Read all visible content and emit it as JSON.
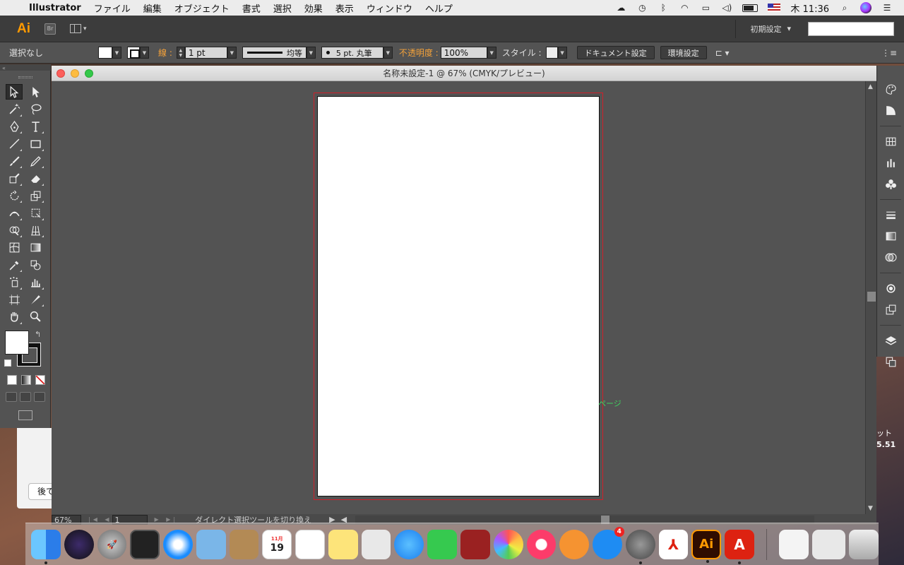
{
  "menubar": {
    "app_name": "Illustrator",
    "menus": [
      "ファイル",
      "編集",
      "オブジェクト",
      "書式",
      "選択",
      "効果",
      "表示",
      "ウィンドウ",
      "ヘルプ"
    ],
    "clock": "木 11:36"
  },
  "appbar": {
    "logo": "Ai",
    "bridge": "Br",
    "workspace": "初期設定"
  },
  "controlbar": {
    "selection": "選択なし",
    "stroke_label": "線 :",
    "stroke_weight": "1 pt",
    "profile": "均等",
    "brush": "5 pt. 丸筆",
    "opacity_label": "不透明度 :",
    "opacity": "100%",
    "style_label": "スタイル :",
    "doc_setup": "ドキュメント設定",
    "preferences": "環境設定"
  },
  "document": {
    "title": "名称未設定-1 @ 67% (CMYK/プレビュー)",
    "smart_guide": "ページ",
    "zoom": "67%",
    "page": "1",
    "status_text": "ダイレクト選択ツールを切り換え"
  },
  "background": {
    "dialog_button": "後で",
    "widget_text": "ット",
    "widget_number": "5.51"
  },
  "dock": {
    "calendar_month": "11月",
    "calendar_day": "19",
    "appstore_badge": "4"
  }
}
